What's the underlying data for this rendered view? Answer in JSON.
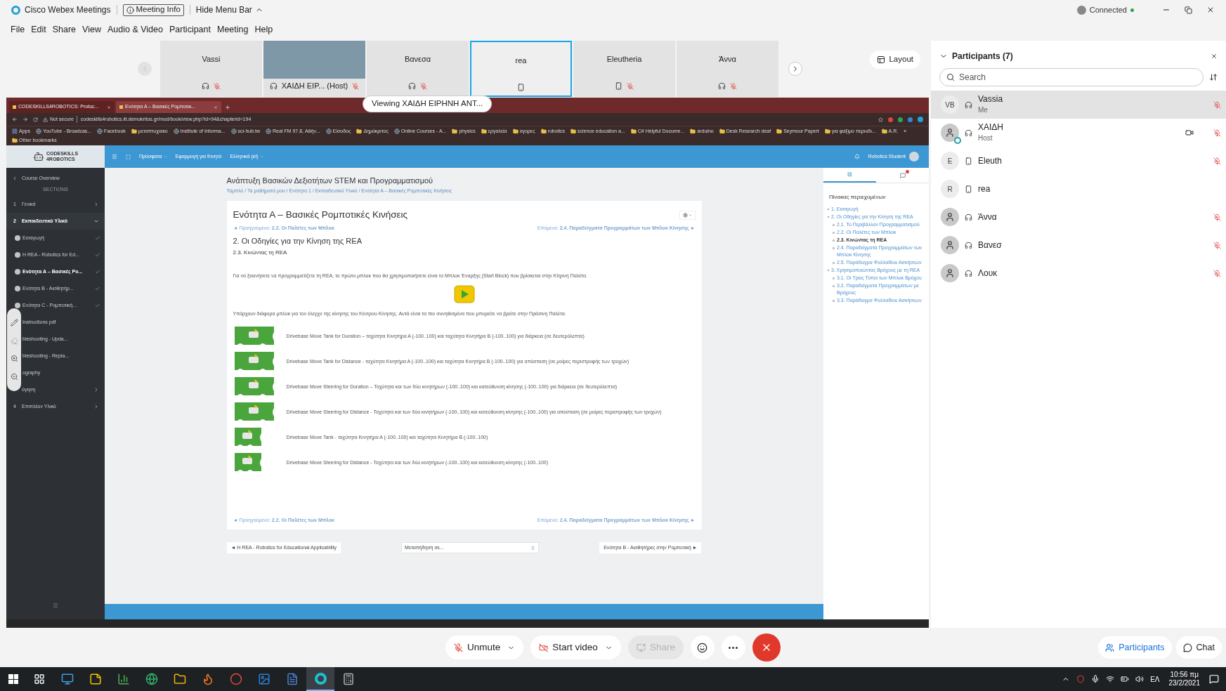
{
  "window": {
    "title": "Cisco Webex Meetings",
    "meeting_info": "Meeting Info",
    "hide_menu": "Hide Menu Bar",
    "status": "Connected"
  },
  "menu": [
    "File",
    "Edit",
    "Share",
    "View",
    "Audio & Video",
    "Participant",
    "Meeting",
    "Help"
  ],
  "thumbnails": [
    {
      "name": "Vassi",
      "kind": "avatar",
      "audio": {
        "kind": "headset"
      },
      "muted": true,
      "selected": false
    },
    {
      "name": "ΧΑΙΔΗ ΕΙΡ...",
      "role": "(Host)",
      "kind": "video",
      "audio": {
        "kind": "headset"
      },
      "muted": true,
      "selected": false
    },
    {
      "name": "Βανεσα",
      "kind": "avatar",
      "audio": {
        "kind": "headset"
      },
      "muted": true,
      "selected": false
    },
    {
      "name": "rea",
      "kind": "avatar",
      "audio": {
        "kind": "phone"
      },
      "muted": false,
      "selected": true
    },
    {
      "name": "Eleutheria",
      "kind": "avatar",
      "audio": {
        "kind": "phone"
      },
      "muted": true,
      "selected": false
    },
    {
      "name": "Άννα",
      "kind": "avatar",
      "audio": {
        "kind": "headset"
      },
      "muted": true,
      "selected": false
    }
  ],
  "layout_button": "Layout",
  "sharing_banner": "Viewing ΧΑΙΔΗ ΕΙΡΗΝΗ ΑΝΤ...",
  "browser": {
    "tabs": [
      {
        "label": "CODESKILLS4ROBOTICS: Protoc...",
        "selected": false
      },
      {
        "label": "Ενότητα Α – Βασικές Ρομποτικ...",
        "selected": true
      }
    ],
    "security": "Not secure",
    "url": "codeskills4robotics.iit.demokritos.gr/mod/book/view.php?id=94&chapterid=194",
    "bookmarks": [
      {
        "label": "Apps",
        "kind": "apps"
      },
      {
        "label": "YouTube - Broadcas...",
        "kind": "site"
      },
      {
        "label": "Facebook",
        "kind": "site"
      },
      {
        "label": "μεταπτυχιακο",
        "kind": "folder"
      },
      {
        "label": "Institute of Informa...",
        "kind": "site"
      },
      {
        "label": "sci-hub.tw",
        "kind": "site"
      },
      {
        "label": "Real FM 97.8, Αθήν...",
        "kind": "site"
      },
      {
        "label": "Είσοδος",
        "kind": "site"
      },
      {
        "label": "Δημόκριτος",
        "kind": "folder"
      },
      {
        "label": "Online Courses - A...",
        "kind": "site"
      },
      {
        "label": "physics",
        "kind": "folder"
      },
      {
        "label": "εργαλεία",
        "kind": "folder"
      },
      {
        "label": "αγορες",
        "kind": "folder"
      },
      {
        "label": "robotics",
        "kind": "folder"
      },
      {
        "label": "science education a...",
        "kind": "folder"
      },
      {
        "label": "C# Helpful Docume...",
        "kind": "folder"
      },
      {
        "label": "arduino",
        "kind": "folder"
      },
      {
        "label": "Desk Research deaf",
        "kind": "folder"
      },
      {
        "label": "Seymour Papert",
        "kind": "folder"
      },
      {
        "label": "για φαξιμο περιοδι...",
        "kind": "folder"
      },
      {
        "label": "A.R.",
        "kind": "folder"
      },
      {
        "label": "»",
        "kind": "more"
      },
      {
        "label": "Other bookmarks",
        "kind": "folder"
      }
    ]
  },
  "site": {
    "logo": [
      "CODESKILLS",
      "4ROBOTICS"
    ],
    "nav": [
      {
        "label": "Πρόσφατα",
        "dropdown": true
      },
      {
        "label": "Εφαρμογή για Κινητό",
        "dropdown": false
      },
      {
        "label": "Ελληνικά (el)",
        "dropdown": true
      }
    ],
    "user": "Robotics Student",
    "sidebar": {
      "title": "Course Overview",
      "heading": "SECTIONS",
      "sections": [
        {
          "number": "1",
          "label": "Γενικά",
          "expanded": false
        },
        {
          "number": "2",
          "label": "Εκπαιδευτικό Υλικό",
          "expanded": true,
          "children": [
            {
              "label": "Εισαγωγή",
              "done": true,
              "selected": false
            },
            {
              "label": "Η REA - Robotics for Ed...",
              "done": true,
              "selected": false
            },
            {
              "label": "Ενότητα Α – Βασικές Ρο...",
              "done": true,
              "selected": true
            },
            {
              "label": "Ενότητα Β - Αισθητήρ...",
              "done": true,
              "selected": false
            },
            {
              "label": "Ενότητα C - Ρομποτική...",
              "done": true,
              "selected": false
            },
            {
              "label": "Instructions pdf",
              "done": false,
              "selected": false
            },
            {
              "label": "bleshooting - Upda...",
              "done": false,
              "selected": false
            },
            {
              "label": "bleshooting - Repla...",
              "done": false,
              "selected": false
            },
            {
              "label": "ography",
              "done": false,
              "selected": false
            }
          ]
        },
        {
          "label": "όγηση",
          "expanded": false
        },
        {
          "number": "4",
          "label": "Επιπλέον Υλικό",
          "expanded": false
        }
      ]
    },
    "course_title": "Ανάπτυξη Βασικών Δεξιοτήτων STEM και Προγραμματισμού",
    "breadcrumb": "Ταμπλό / Τα μαθήματά μου / Ενότητα 1 / Εκπαιδευτικό Υλικό / Ενότητα Α – Βασικές Ρομποτικές Κινήσεις",
    "card": {
      "title": "Ενότητα Α – Βασικές Ρομποτικές Κινήσεις",
      "prev_top": "◄ Προηγούμενο: **2.2. Οι Παλέτες των Μπλοκ**",
      "next_top": "Επόμενο: **2.4. Παραδείγματα Προγραμμάτων των Μπλοκ Κίνησης** ►",
      "chapter": "2. Οι Οδηγίες για την Κίνηση της REA",
      "subchapter": "2.3. Κινώντας τη REA",
      "intro": "Για να ξεκινήσετε να προγραμματίζετε τη REA, το πρώτο μπλοκ που θα χρησιμοποιήσετε είναι το Μπλοκ Έναρξης (Start Block) που βρίσκεται στην Κίτρινη Παλέτα.",
      "outro": "Υπάρχουν διάφορα μπλοκ για τον έλεγχο της κίνησης του Κέντρου Κίνησης. Αυτά είναι τα πιο συνηθισμένα που μπορείτε να βρείτε στην Πράσινη Παλέτα.",
      "blocks": [
        {
          "kind": "long",
          "text": "Drivebase Move Tank for Duration – ταχύτητα Κινητήρα Α (-100..100) και ταχύτητα Κινητήρα Β (-100..100) για διάρκεια (σε δευτερόλεπτα)"
        },
        {
          "kind": "long",
          "text": "Drivebase Move Tank for Distance - ταχύτητα Κινητήρα Α (-100..100) και ταχύτητα Κινητήρα Β (-100..100) για απόσταση (σε μοίρες περιστροφής των τροχών)"
        },
        {
          "kind": "long",
          "text": "Drivebase Move Steering for Duration – Ταχύτητα και των δύο κινητήρων (-100..100) και κατεύθυνση κίνησης (-100..100) για διάρκεια (σε δευτερόλεπτα)"
        },
        {
          "kind": "long",
          "text": "Drivebase Move Steering for Distance - Ταχύτητα και των δύο κινητήρων (-100..100) και κατεύθυνση κίνησης (-100..100) για απόσταση (σε μοίρες περιστροφής των τροχών)"
        },
        {
          "kind": "short",
          "text": "Drivebase Move Tank - ταχύτητα Κινητήρα Α (-100..100) και ταχύτητα Κινητήρα Β (-100..100)"
        },
        {
          "kind": "short",
          "text": "Drivebase Move Steering for Distance - Ταχύτητα και των δύο κινητήρων (-100..100) και κατεύθυνση κίνησης (-100..100)"
        }
      ],
      "prev_bottom": "◄ Προηγούμενο: **2.2. Οι Παλέτες των Μπλοκ**",
      "next_bottom": "Επόμενο: **2.4. Παραδείγματα Προγραμμάτων των Μπλοκ Κίνησης** ►"
    },
    "prev_activity": "◄ Η REA - Robotics for Educational Applicability",
    "jump_select": "Μεταπήδηση σε...",
    "next_activity": "Ενότητα Β - Αισθητήρες στην Ρομποτική ►",
    "toc": {
      "title": "Πίνακας περιεχομένων",
      "items": [
        {
          "label": "1. Εισαγωγή",
          "selected": false
        },
        {
          "label": "2. Οι Οδηγίες για την Κίνηση της REA",
          "selected": false,
          "children": [
            {
              "label": "2.1. Το Περιβάλλον Προγραμματισμού",
              "selected": false
            },
            {
              "label": "2.2. Οι Παλέτες των Μπλοκ",
              "selected": false
            },
            {
              "label": "2.3. Κινώντας τη REA",
              "selected": true
            },
            {
              "label": "2.4. Παραδείγματα Προγραμμάτων των Μπλοκ Κίνησης",
              "selected": false
            },
            {
              "label": "2.5. Παράδειγμα Φυλλαδίου Ασκήσεων",
              "selected": false
            }
          ]
        },
        {
          "label": "3. Χρησιμοποιώντας Βρόχους με τη REA",
          "selected": false,
          "children": [
            {
              "label": "3.1. Οι Τρεις Τύποι των Μπλοκ Βρόχου",
              "selected": false
            },
            {
              "label": "3.2. Παραδείγματα Προγραμμάτων με Βρόχους",
              "selected": false
            },
            {
              "label": "3.3. Παράδειγμα Φυλλαδίου Ασκήσεων",
              "selected": false
            }
          ]
        }
      ]
    }
  },
  "participants": {
    "title": "Participants (7)",
    "search_placeholder": "Search",
    "items": [
      {
        "initials": "VB",
        "name": "Vassia",
        "subtitle": "Me",
        "audio": {
          "kind": "headset"
        },
        "video": false,
        "muted": true,
        "presenting": false,
        "selected": true
      },
      {
        "name": "ΧΑΙΔΗ",
        "subtitle": "Host",
        "audio": {
          "kind": "headset"
        },
        "video": true,
        "muted": true,
        "presenting": true,
        "selected": false
      },
      {
        "initials": "E",
        "name": "Eleuth",
        "audio": {
          "kind": "phone"
        },
        "video": false,
        "muted": true,
        "presenting": false,
        "selected": false
      },
      {
        "initials": "R",
        "name": "rea",
        "audio": {
          "kind": "phone"
        },
        "video": false,
        "muted": false,
        "presenting": false,
        "selected": false
      },
      {
        "name": "Άννα",
        "audio": {
          "kind": "headset"
        },
        "video": false,
        "muted": true,
        "presenting": false,
        "selected": false
      },
      {
        "name": "Βανεσ",
        "audio": {
          "kind": "headset"
        },
        "video": false,
        "muted": true,
        "presenting": false,
        "selected": false
      },
      {
        "name": "Λουκ",
        "audio": {
          "kind": "headset"
        },
        "video": false,
        "muted": true,
        "presenting": false,
        "selected": false
      }
    ]
  },
  "controls": [
    {
      "kind": "mute",
      "label": "Unmute",
      "disabled": false
    },
    {
      "kind": "video",
      "label": "Start video",
      "disabled": false
    },
    {
      "kind": "share",
      "label": "Share",
      "disabled": true
    }
  ],
  "panel_buttons": [
    {
      "kind": "participants",
      "label": "Participants",
      "selected": true
    },
    {
      "kind": "chat",
      "label": "Chat",
      "selected": false
    }
  ],
  "taskbar": {
    "apps": [
      {
        "kind": "monitor",
        "active": false
      },
      {
        "kind": "note",
        "active": false
      },
      {
        "kind": "chart",
        "active": false
      },
      {
        "kind": "globe",
        "active": false
      },
      {
        "kind": "folder",
        "active": false
      },
      {
        "kind": "flame",
        "active": false
      },
      {
        "kind": "circle",
        "active": false
      },
      {
        "kind": "image",
        "active": false
      },
      {
        "kind": "document",
        "active": false
      },
      {
        "kind": "webex",
        "active": true
      },
      {
        "kind": "calculator",
        "active": false
      }
    ],
    "language": "ΕΛ",
    "time": "10:56 πμ",
    "date": "23/2/2021"
  }
}
